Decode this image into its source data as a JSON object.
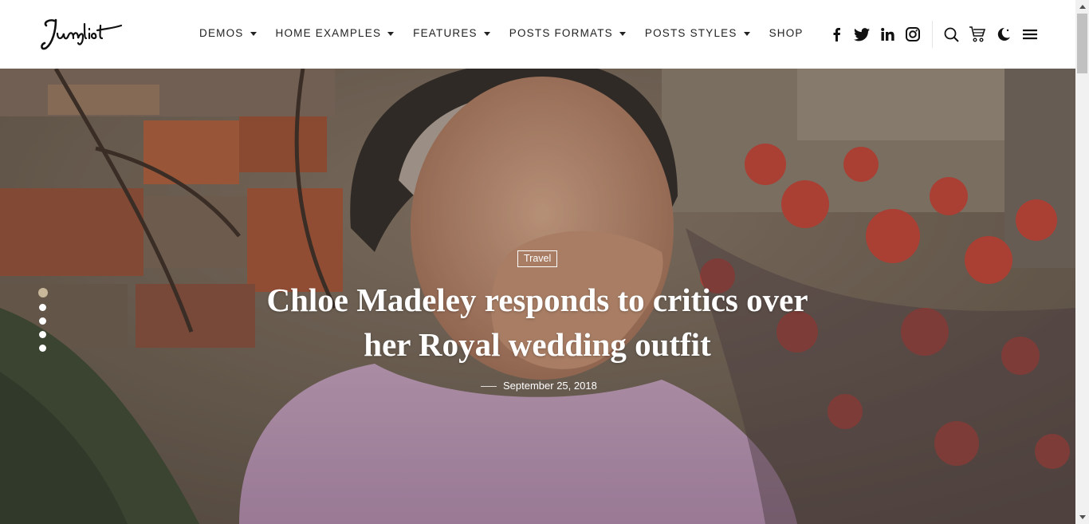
{
  "brand": {
    "logo_text": "Junglist"
  },
  "nav": {
    "items": [
      {
        "label": "DEMOS",
        "has_dropdown": true
      },
      {
        "label": "HOME EXAMPLES",
        "has_dropdown": true
      },
      {
        "label": "FEATURES",
        "has_dropdown": true
      },
      {
        "label": "POSTS FORMATS",
        "has_dropdown": true
      },
      {
        "label": "POSTS STYLES",
        "has_dropdown": true
      },
      {
        "label": "SHOP",
        "has_dropdown": false
      }
    ]
  },
  "social": {
    "icons": [
      "facebook-icon",
      "twitter-icon",
      "linkedin-icon",
      "instagram-icon"
    ]
  },
  "tools": {
    "icons": [
      "search-icon",
      "cart-icon",
      "dark-mode-icon",
      "menu-icon"
    ]
  },
  "hero": {
    "category": "Travel",
    "title": "Chloe Madeley responds to critics over her Royal wedding outfit",
    "date": "September 25, 2018",
    "slide_count": 5,
    "active_slide": 1
  },
  "colors": {
    "active_dot": "#c9b79a",
    "text_dark": "#222222"
  }
}
